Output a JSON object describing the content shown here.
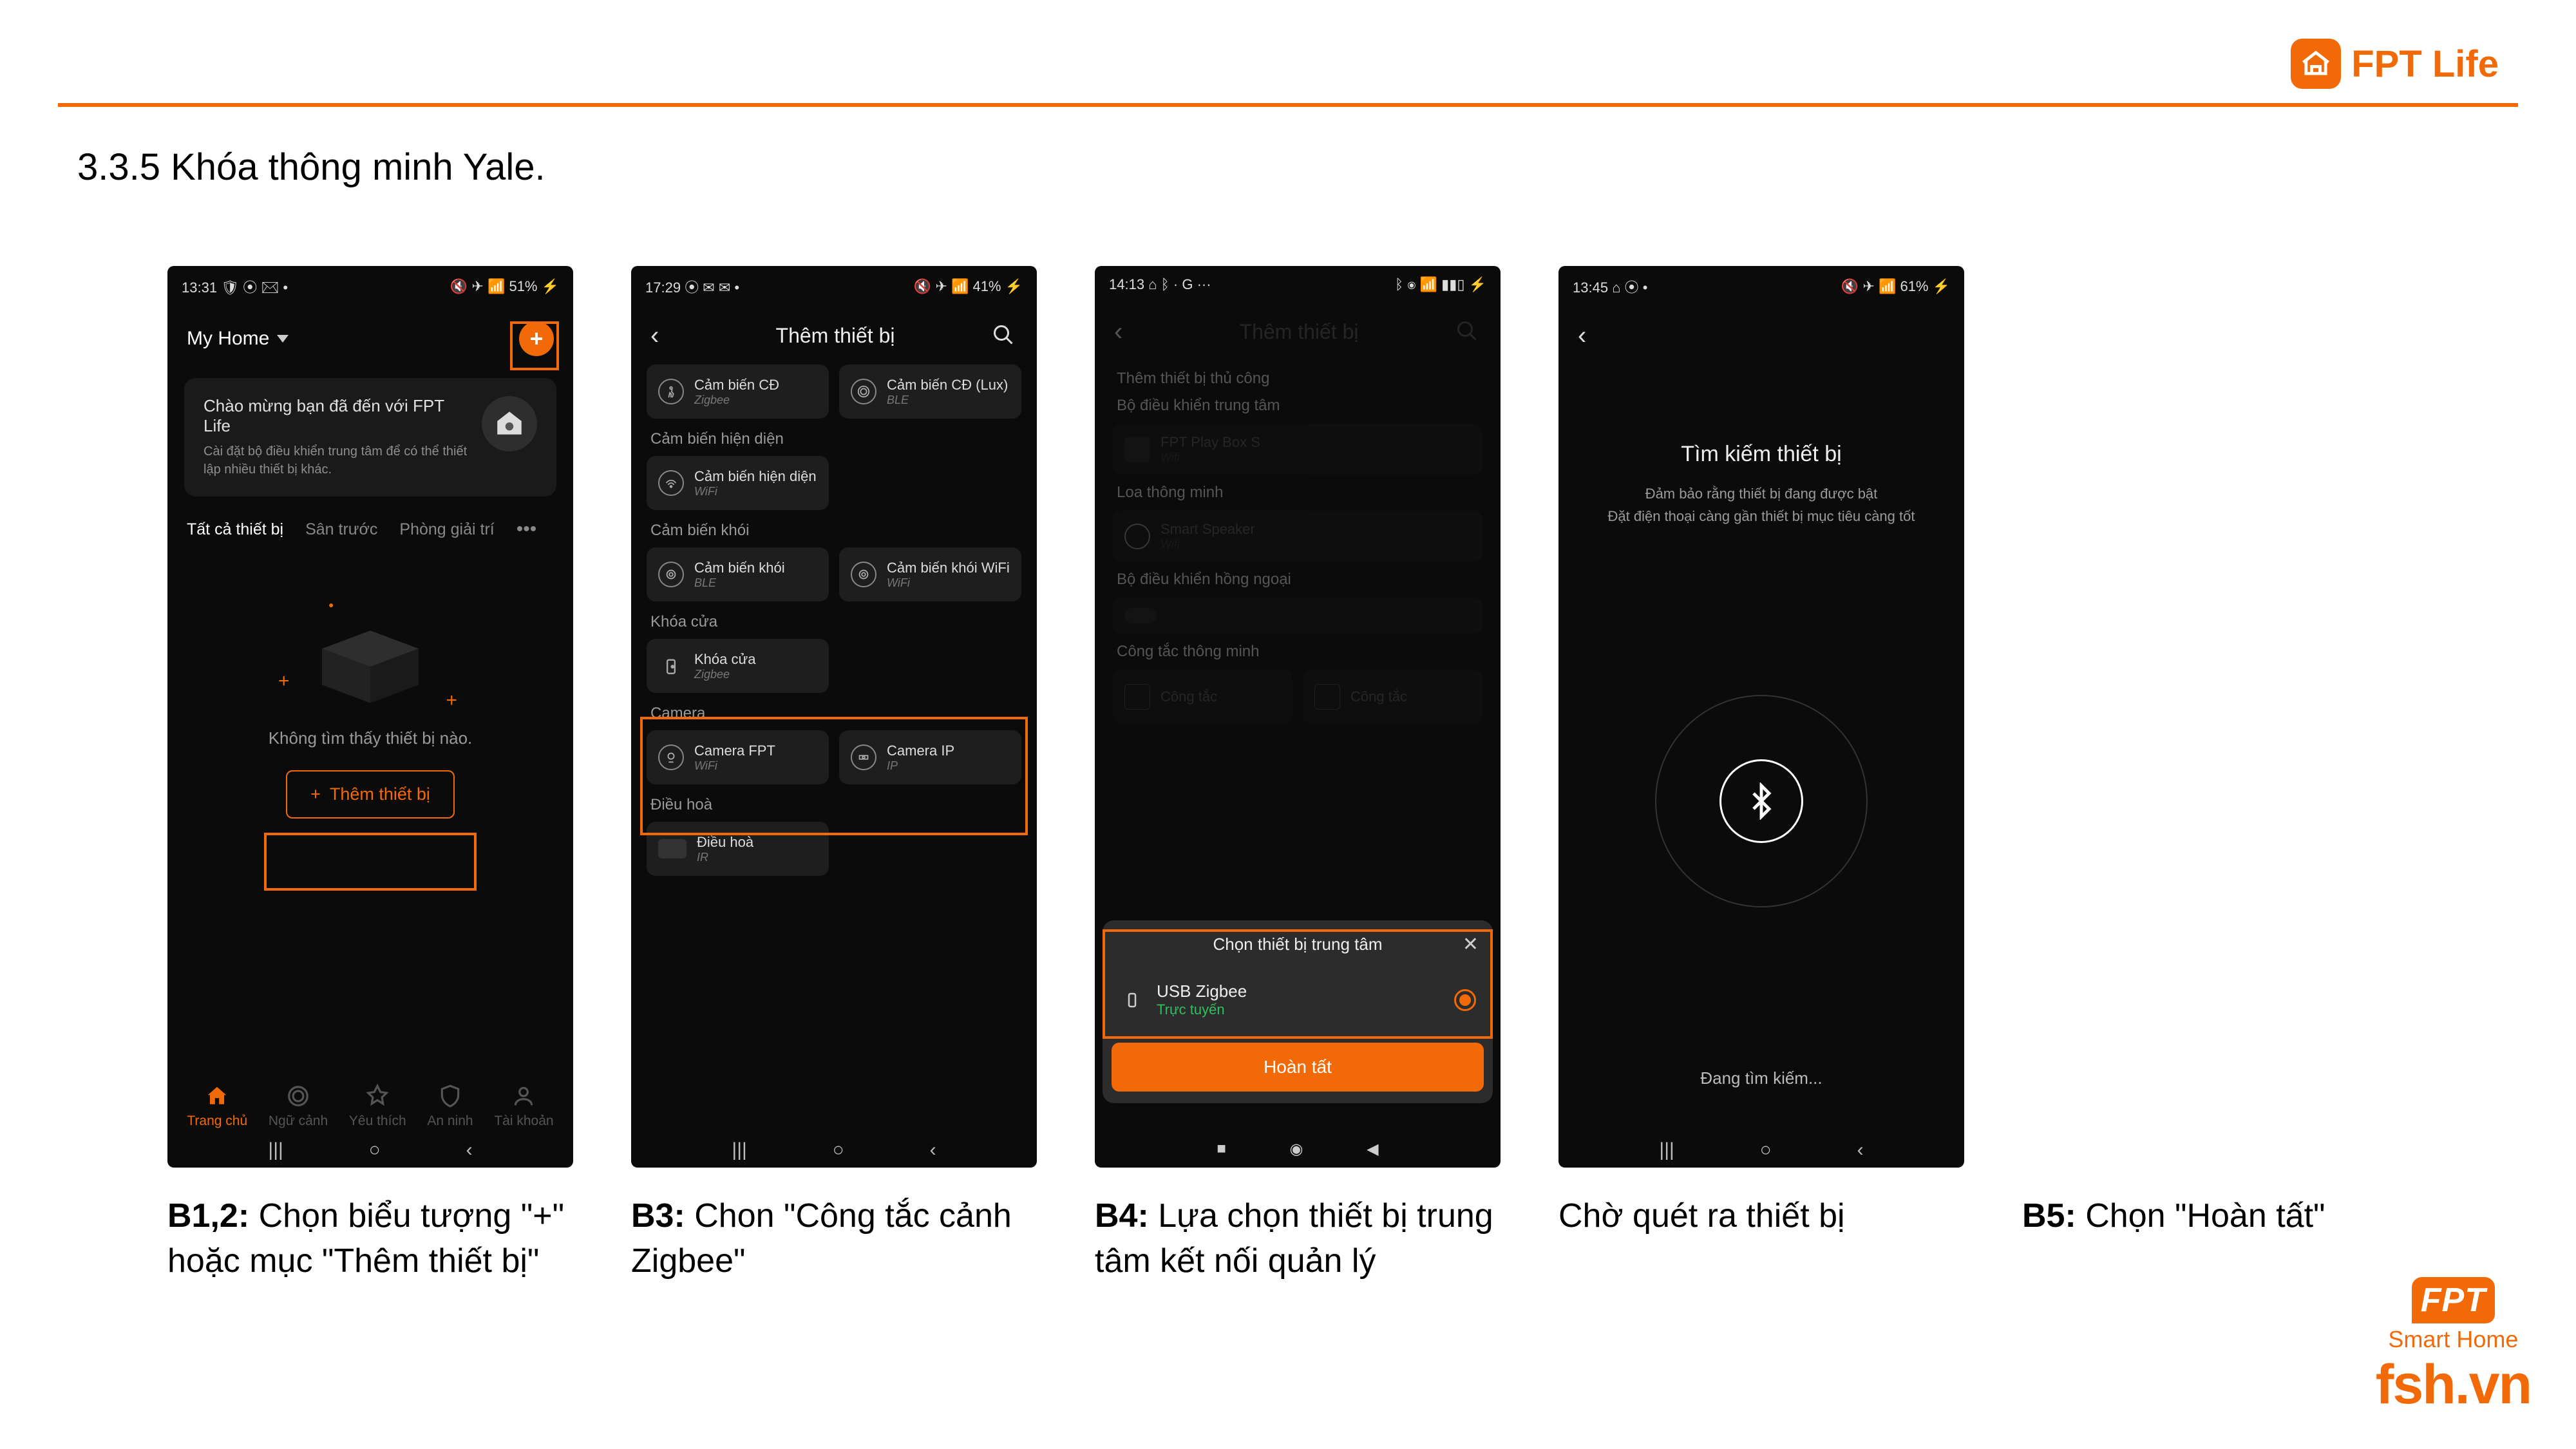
{
  "brand": {
    "top_label": "FPT Life",
    "footer_fpt": "FPT",
    "footer_smart_home": "Smart Home",
    "footer_site": "fsh.vn"
  },
  "section_title": "3.3.5 Khóa thông minh Yale.",
  "captions": {
    "c1_bold": "B1,2:",
    "c1_rest": " Chọn biểu tượng \"+\" hoặc mục \"Thêm thiết bị\"",
    "c2_bold": "B3:",
    "c2_rest": " Chon \"Công tắc cảnh Zigbee\"",
    "c3_bold": "B4:",
    "c3_rest": " Lựa chọn thiết bị trung tâm kết nối quản lý",
    "c4": "Chờ quét ra thiết bị",
    "c5_bold": "B5:",
    "c5_rest": " Chọn \"Hoàn tất\""
  },
  "phone_common": {
    "sys_menu": "|||",
    "sys_home": "○",
    "sys_back": "‹"
  },
  "phone1": {
    "time": "13:31",
    "left_icons": "🛡 ⦿ ✉ •",
    "right_status": "🔇 ✈ 📶 51% ⚡",
    "my_home": "My Home",
    "welcome_title": "Chào mừng bạn đã đến với FPT Life",
    "welcome_sub": "Cài đặt bộ điều khiển trung tâm để có thể thiết lập nhiều thiết bị khác.",
    "tab_all": "Tất cả thiết bị",
    "tab_san": "Sân trước",
    "tab_phong": "Phòng giải trí",
    "empty": "Không tìm thấy thiết bị nào.",
    "add_label": "Thêm thiết bị",
    "nav": {
      "home": "Trang chủ",
      "scene": "Ngữ cảnh",
      "fav": "Yêu thích",
      "security": "An ninh",
      "acc": "Tài khoản"
    }
  },
  "phone2": {
    "time": "17:29",
    "left_icons": "⦿ ✉ ✉ •",
    "right_status": "🔇 ✈ 📶 41% ⚡",
    "title": "Thêm thiết bị",
    "items": {
      "cb_cd": "Cảm biến CĐ",
      "zigbee": "Zigbee",
      "cb_cd_lux": "Cảm biến CĐ (Lux)",
      "ble": "BLE",
      "cat_hien_dien": "Cảm biến hiện diện",
      "cb_hd": "Cảm biến hiện diện",
      "wifi": "WiFi",
      "cat_khoi": "Cảm biến khói",
      "cb_khoi": "Cảm biến khói",
      "cb_khoi_wifi": "Cảm biến khói WiFi",
      "cat_khoa": "Khóa cửa",
      "khoa_cua": "Khóa cửa",
      "cat_camera": "Camera",
      "camera_fpt": "Camera FPT",
      "camera_ip": "Camera IP",
      "ip": "IP",
      "cat_dh": "Điều hoà",
      "dieu_hoa": "Điều hoà",
      "ir": "IR"
    }
  },
  "phone3": {
    "time": "14:13",
    "left_icons": "⌂ ᛒ · G ···",
    "right_status": "ᛒ ⦿ 📶 ▮▮▯ ⚡",
    "title": "Thêm thiết bị",
    "cat_thu_cong": "Thêm thiết bị thủ công",
    "cat_center": "Bộ điều khiển trung tâm",
    "fpt_box": "FPT Play Box S",
    "cat_loa": "Loa thông minh",
    "smart_speaker": "Smart Speaker",
    "cat_ir": "Bộ điều khiển hồng ngoại",
    "cat_switch": "Công tắc thông minh",
    "switch": "Công tắc",
    "sheet_title": "Chọn thiết bị trung tâm",
    "usb_zigbee": "USB Zigbee",
    "online": "Trực tuyến",
    "done": "Hoàn tất"
  },
  "phone4": {
    "time": "13:45",
    "left_icons": "⌂ ⦿ •",
    "right_status": "🔇 ✈ 📶 61% ⚡",
    "title": "Tìm kiếm thiết bị",
    "sub1": "Đảm bảo rằng thiết bị đang được bật",
    "sub2": "Đặt điện thoại càng gần thiết bị mục tiêu càng tốt",
    "status": "Đang tìm kiếm..."
  }
}
